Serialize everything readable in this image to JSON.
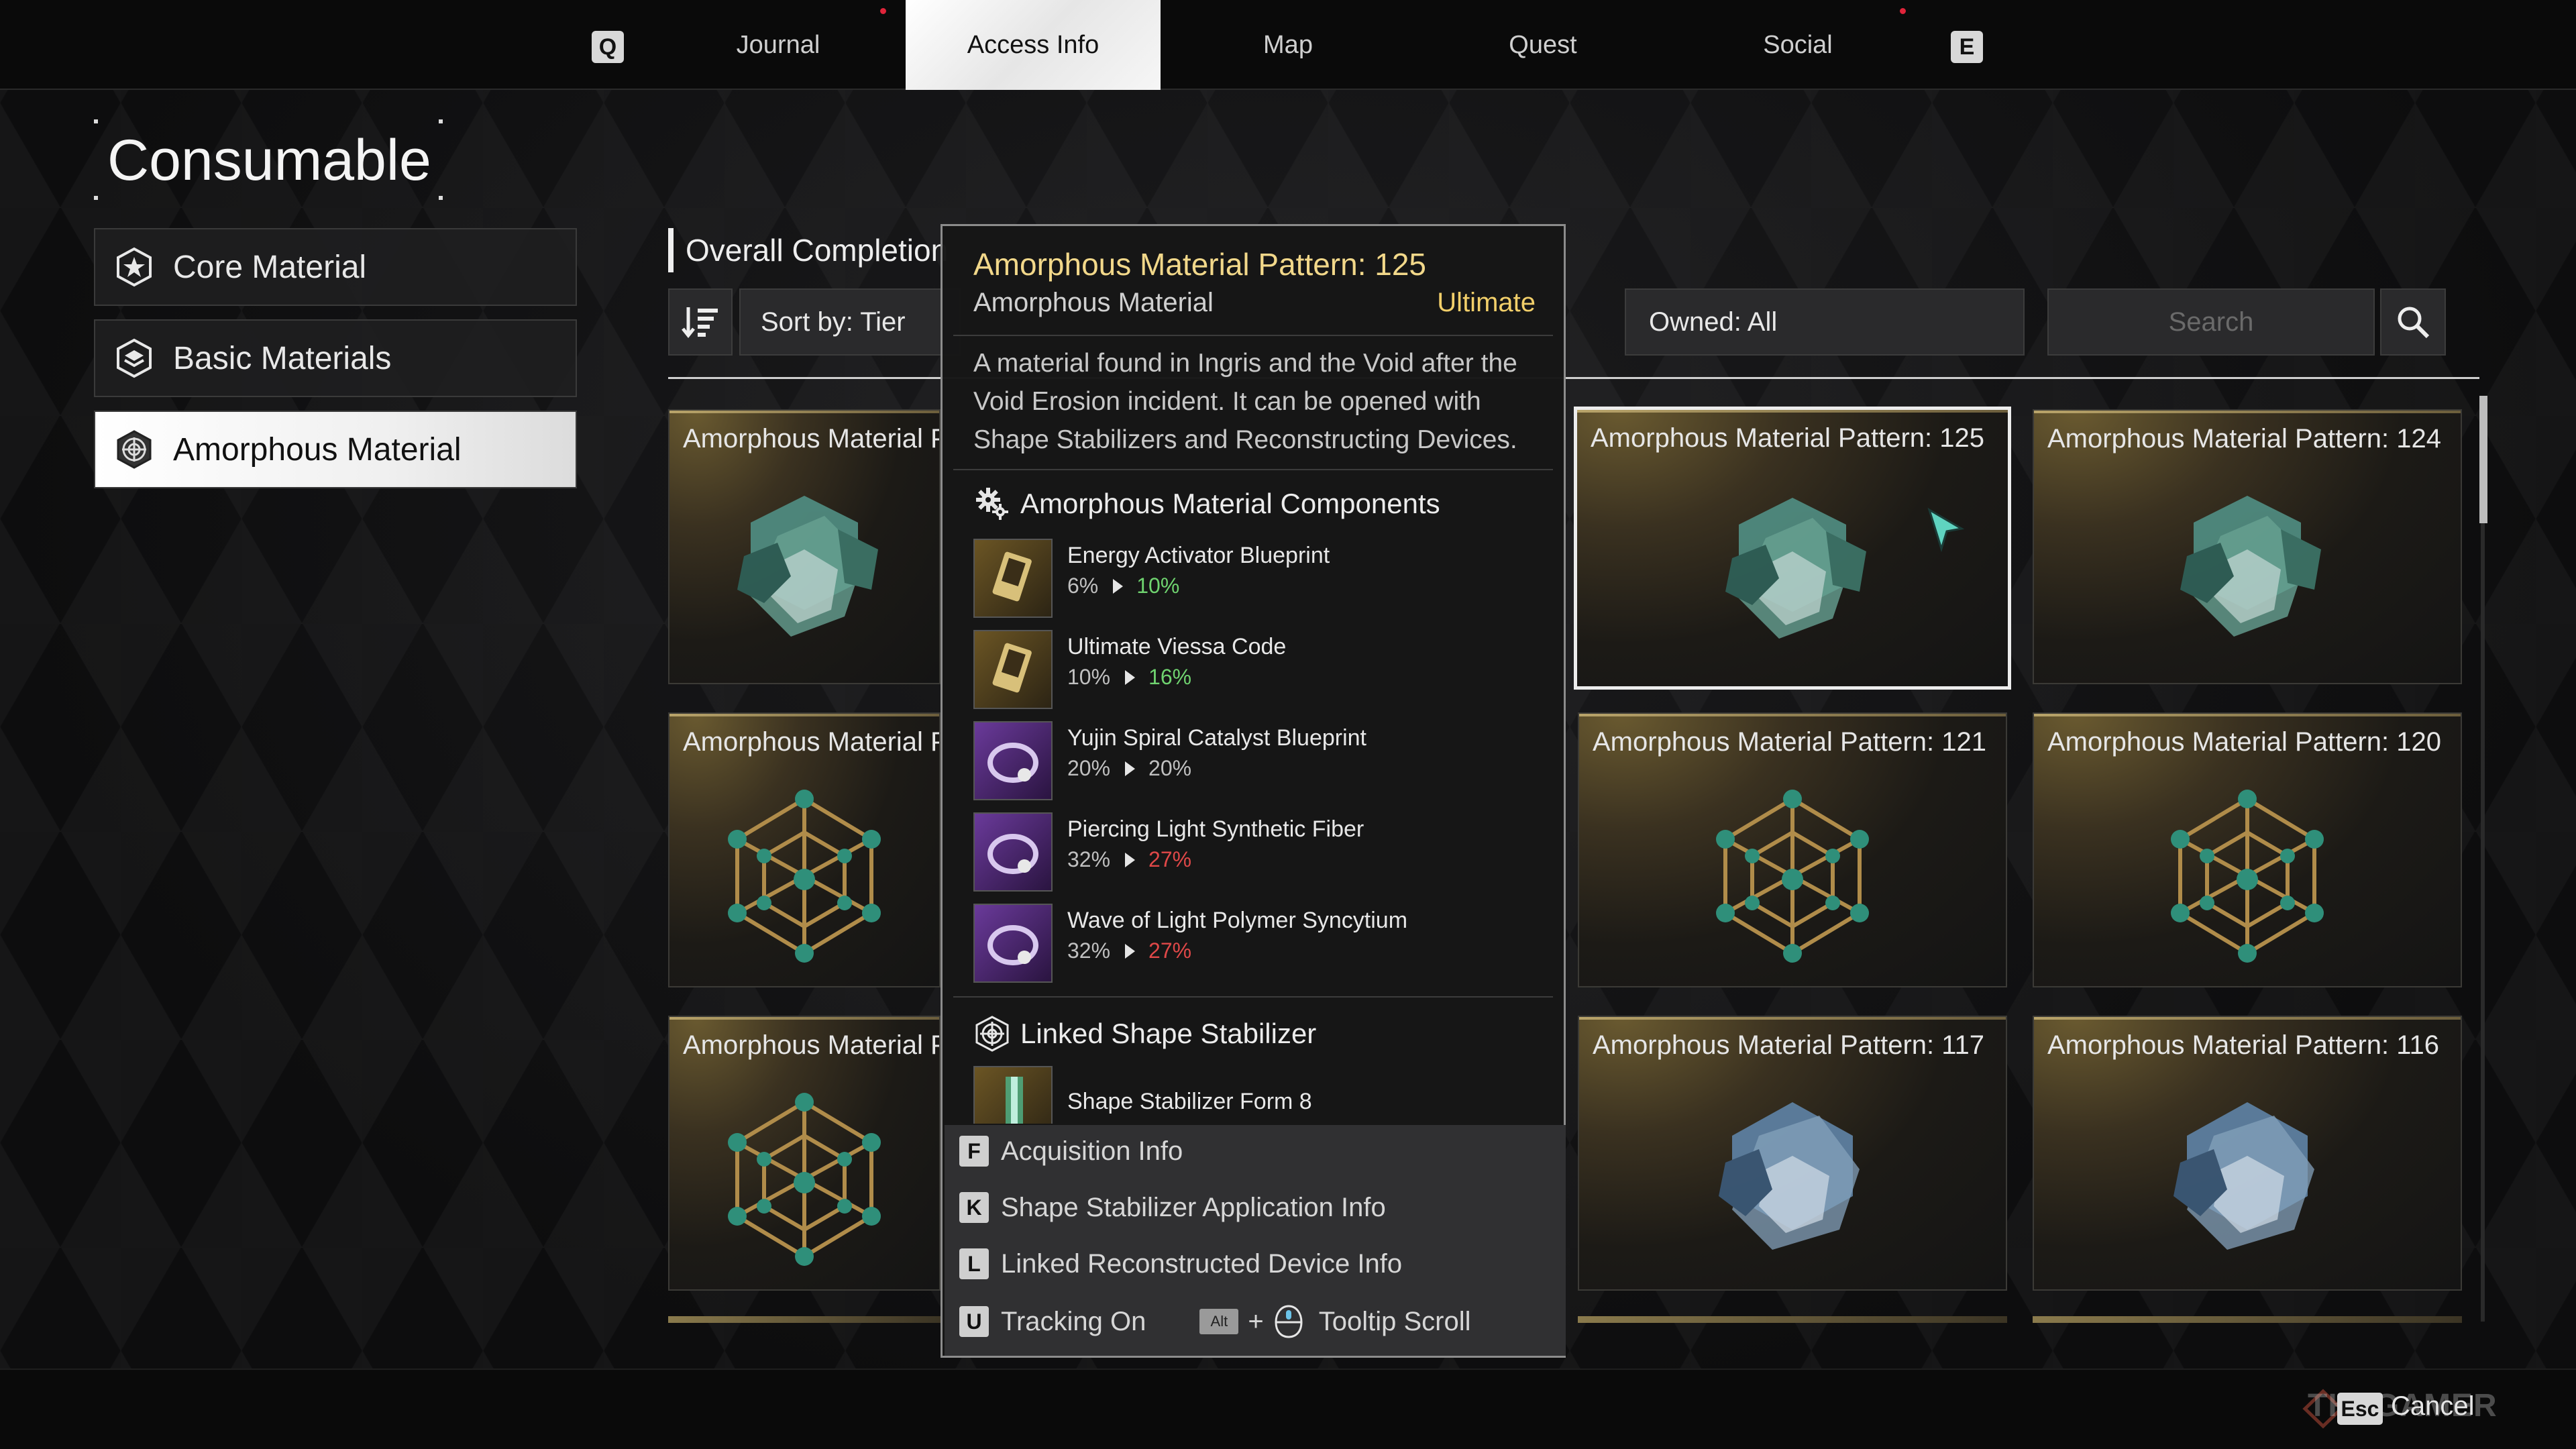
{
  "nav": {
    "left_key": "Q",
    "right_key": "E",
    "tabs": [
      {
        "label": "Journal"
      },
      {
        "label": "Access Info"
      },
      {
        "label": "Map"
      },
      {
        "label": "Quest"
      },
      {
        "label": "Social"
      }
    ],
    "active_tab": "Access Info"
  },
  "sidebar": {
    "title": "Consumable",
    "items": [
      {
        "label": "Core Material",
        "icon": "star-hexagon-icon"
      },
      {
        "label": "Basic Materials",
        "icon": "layers-hexagon-icon"
      },
      {
        "label": "Amorphous Material",
        "icon": "web-hexagon-icon",
        "active": true
      }
    ]
  },
  "toolbar": {
    "overall_label": "Overall Completion",
    "sort_label": "Sort by: Tier",
    "owned_label": "Owned: All",
    "search_placeholder": "Search"
  },
  "grid": {
    "cards": [
      {
        "title": "Amorphous Material Pa",
        "art": "cube-cluster"
      },
      {
        "title": "Amorphous Material Pattern: 125",
        "art": "cube-cluster",
        "selected": true
      },
      {
        "title": "Amorphous Material Pattern: 124",
        "art": "cube-cluster"
      },
      {
        "title": "Amorphous Material Pa",
        "art": "lattice"
      },
      {
        "title": "Amorphous Material Pattern: 121",
        "art": "lattice"
      },
      {
        "title": "Amorphous Material Pattern: 120",
        "art": "lattice"
      },
      {
        "title": "Amorphous Material Pa",
        "art": "lattice"
      },
      {
        "title": "Amorphous Material Pattern: 117",
        "art": "blue-cluster"
      },
      {
        "title": "Amorphous Material Pattern: 116",
        "art": "blue-cluster"
      }
    ]
  },
  "tooltip": {
    "title": "Amorphous Material Pattern: 125",
    "subtitle": "Amorphous Material",
    "tier": "Ultimate",
    "description": "A material found in Ingris and the Void after the Void Erosion incident. It can be opened with Shape Stabilizers and Reconstructing Devices.",
    "components_title": "Amorphous Material Components",
    "components": [
      {
        "name": "Energy Activator Blueprint",
        "base": "6%",
        "boosted": "10%",
        "trend": "up",
        "color": "gold"
      },
      {
        "name": "Ultimate Viessa Code",
        "base": "10%",
        "boosted": "16%",
        "trend": "up",
        "color": "gold"
      },
      {
        "name": "Yujin Spiral Catalyst Blueprint",
        "base": "20%",
        "boosted": "20%",
        "trend": "same",
        "color": "purple"
      },
      {
        "name": "Piercing Light Synthetic Fiber",
        "base": "32%",
        "boosted": "27%",
        "trend": "down",
        "color": "purple"
      },
      {
        "name": "Wave of Light Polymer Syncytium",
        "base": "32%",
        "boosted": "27%",
        "trend": "down",
        "color": "purple"
      }
    ],
    "linked_title": "Linked Shape Stabilizer",
    "linked_item": "Shape Stabilizer Form 8",
    "footer": [
      {
        "key": "F",
        "label": "Acquisition Info"
      },
      {
        "key": "K",
        "label": "Shape Stabilizer Application Info"
      },
      {
        "key": "L",
        "label": "Linked Reconstructed Device Info"
      },
      {
        "key": "U",
        "label": "Tracking On"
      }
    ],
    "scroll_key": "Alt",
    "scroll_plus": "+",
    "scroll_label": "Tooltip Scroll"
  },
  "bottom": {
    "esc_key": "Esc",
    "cancel_label": "Cancel",
    "watermark": "THEGAMER"
  },
  "colors": {
    "gold_text": "#f2d88a",
    "tier_gold": "#f2cf6a",
    "up_green": "#6fd36f",
    "down_red": "#e04848"
  }
}
